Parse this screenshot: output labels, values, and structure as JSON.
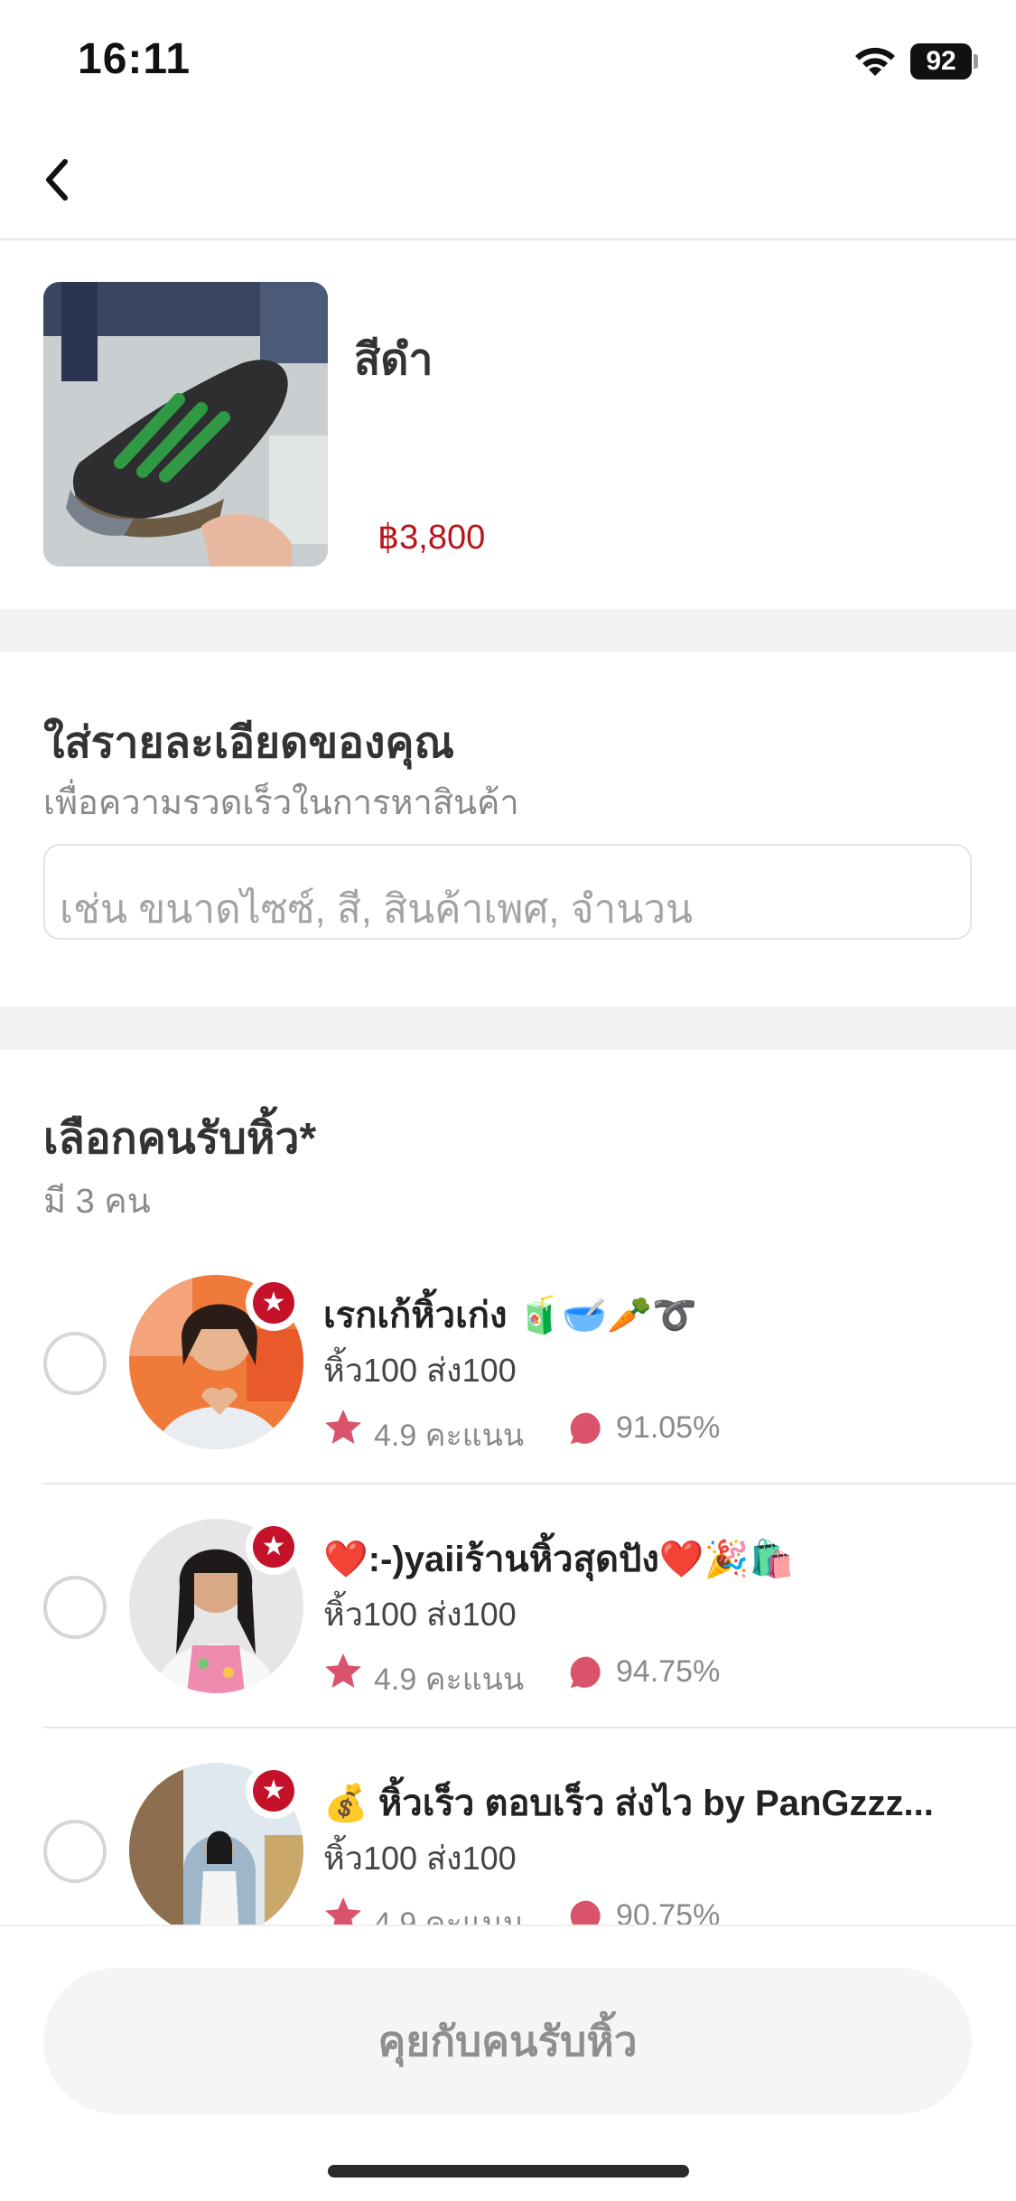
{
  "status_bar": {
    "time": "16:11",
    "battery": "92"
  },
  "product": {
    "name": "สีดำ",
    "price": "฿3,800"
  },
  "details": {
    "title": "ใส่รายละเอียดของคุณ",
    "subtitle": "เพื่อความรวดเร็วในการหาสินค้า",
    "placeholder": "เช่น ขนาดไซซ์, สี, สินค้าเพศ, จำนวน"
  },
  "helpers": {
    "title": "เลือกคนรับหิ้ว*",
    "count": "มี 3 คน",
    "items": [
      {
        "name": "เรกเก้หิ้วเก่ง 🧃🥣🥕➰",
        "desc": "หิ้ว100 ส่ง100",
        "rating": "4.9 คะแนน",
        "response": "91.05%"
      },
      {
        "name": "❤️:-)yaiiร้านหิ้วสุดปัง❤️🎉🛍️",
        "desc": "หิ้ว100 ส่ง100",
        "rating": "4.9 คะแนน",
        "response": "94.75%"
      },
      {
        "name": "💰 หิ้วเร็ว ตอบเร็ว ส่งไว by PanGzzz...",
        "desc": "หิ้ว100 ส่ง100",
        "rating": "4.9 คะแนน",
        "response": "90.75%"
      }
    ]
  },
  "cta": {
    "label": "คุยกับคนรับหิ้ว"
  },
  "colors": {
    "price": "#b8151b",
    "badge": "#c3122a",
    "star": "#d9536b"
  }
}
